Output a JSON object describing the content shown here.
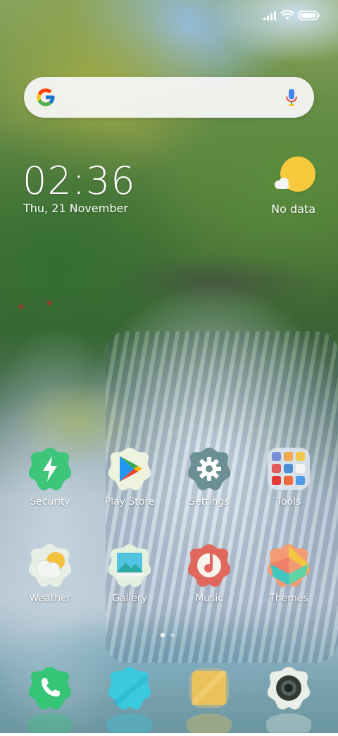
{
  "status_bar": {
    "signal_icon": "cellular-signal-icon",
    "wifi_icon": "wifi-icon",
    "battery_icon": "battery-icon"
  },
  "search": {
    "logo_icon": "google-g-icon",
    "mic_icon": "microphone-icon"
  },
  "clock": {
    "time": "02:36",
    "date": "Thu, 21 November"
  },
  "weather": {
    "icon": "sun-cloud-icon",
    "status": "No data"
  },
  "apps": [
    {
      "label": "Security",
      "icon": "security-bolt-icon",
      "color": "#3dc57a"
    },
    {
      "label": "Play Store",
      "icon": "play-store-icon",
      "color": "#eef3df"
    },
    {
      "label": "Settings",
      "icon": "gear-icon",
      "color": "#6b8f94"
    },
    {
      "label": "Tools",
      "icon": "folder-tools-icon",
      "color": "#dfe6ee"
    },
    {
      "label": "Weather",
      "icon": "weather-icon",
      "color": "#e7eee6"
    },
    {
      "label": "Gallery",
      "icon": "gallery-icon",
      "color": "#e4f1df"
    },
    {
      "label": "Music",
      "icon": "music-note-icon",
      "color": "#e0675c"
    },
    {
      "label": "Themes",
      "icon": "themes-icon",
      "color": "#f29b75"
    }
  ],
  "dock": [
    {
      "icon": "phone-icon",
      "color": "#36c477"
    },
    {
      "icon": "messages-icon",
      "color": "#3ac9df"
    },
    {
      "icon": "browser-icon",
      "color": "#e9c25c"
    },
    {
      "icon": "camera-icon",
      "color": "#e9eee6"
    }
  ],
  "page_indicator": {
    "pages": 2,
    "active": 1
  }
}
